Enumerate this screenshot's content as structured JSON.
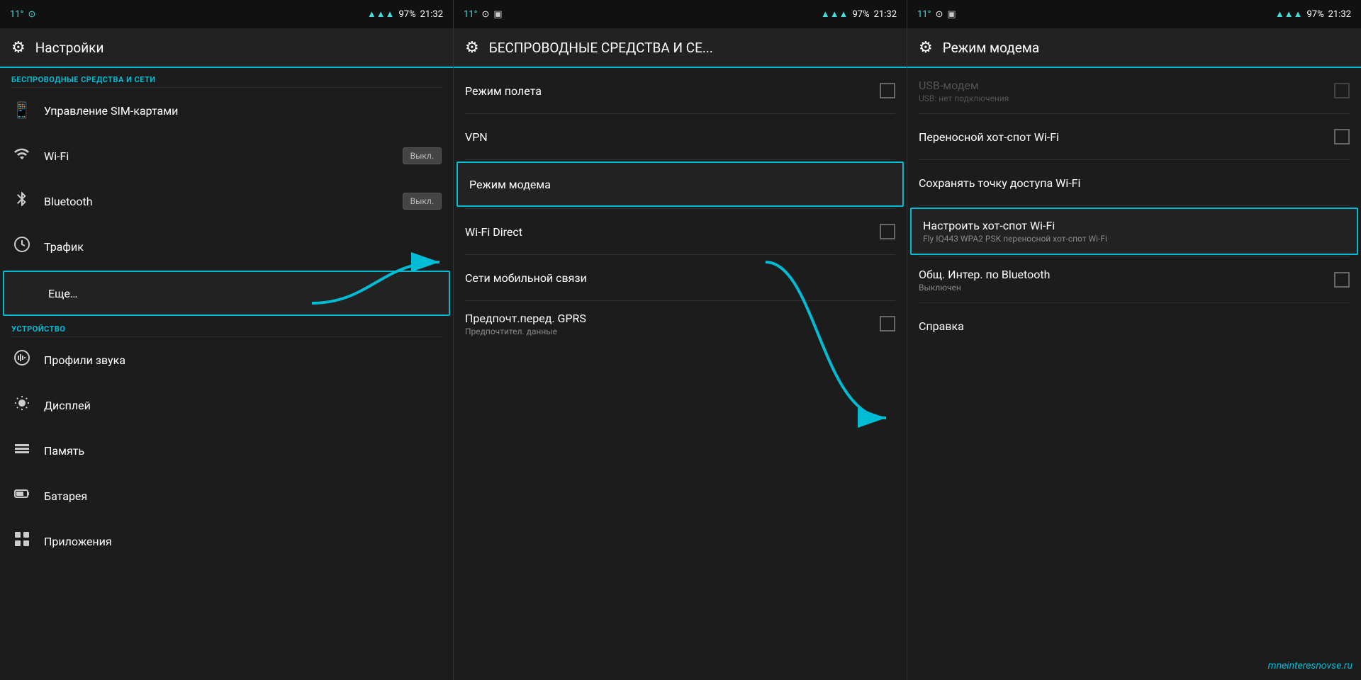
{
  "panel1": {
    "statusBar": {
      "temp": "11°",
      "battery": "97%",
      "time": "21:32"
    },
    "header": {
      "title": "Настройки",
      "icon": "⚙"
    },
    "sections": [
      {
        "label": "БЕСПРОВОДНЫЕ СРЕДСТВА И СЕТИ",
        "items": [
          {
            "icon": "📶",
            "title": "Управление SIM-картами",
            "toggle": null,
            "subtitle": ""
          },
          {
            "icon": "wifi",
            "title": "Wi-Fi",
            "toggle": "Выкл.",
            "subtitle": ""
          },
          {
            "icon": "bluetooth",
            "title": "Bluetooth",
            "toggle": "Выкл.",
            "subtitle": ""
          },
          {
            "icon": "traffic",
            "title": "Трафик",
            "toggle": null,
            "subtitle": ""
          },
          {
            "icon": "more",
            "title": "Еще…",
            "toggle": null,
            "subtitle": "",
            "highlighted": true
          }
        ]
      },
      {
        "label": "УСТРОЙСТВО",
        "items": [
          {
            "icon": "sound",
            "title": "Профили звука",
            "toggle": null,
            "subtitle": ""
          },
          {
            "icon": "display",
            "title": "Дисплей",
            "toggle": null,
            "subtitle": ""
          },
          {
            "icon": "memory",
            "title": "Память",
            "toggle": null,
            "subtitle": ""
          },
          {
            "icon": "battery",
            "title": "Батарея",
            "toggle": null,
            "subtitle": ""
          },
          {
            "icon": "apps",
            "title": "Приложения",
            "toggle": null,
            "subtitle": ""
          }
        ]
      }
    ]
  },
  "panel2": {
    "statusBar": {
      "temp": "11°",
      "battery": "97%",
      "time": "21:32"
    },
    "header": {
      "title": "БЕСПРОВОДНЫЕ СРЕДСТВА И СЕ...",
      "icon": "⚙"
    },
    "items": [
      {
        "title": "Режим полета",
        "subtitle": "",
        "checkbox": true,
        "checked": false,
        "highlighted": false
      },
      {
        "title": "VPN",
        "subtitle": "",
        "checkbox": false,
        "checked": false,
        "highlighted": false
      },
      {
        "title": "Режим модема",
        "subtitle": "",
        "checkbox": false,
        "checked": false,
        "highlighted": true
      },
      {
        "title": "Wi-Fi Direct",
        "subtitle": "",
        "checkbox": true,
        "checked": false,
        "highlighted": false
      },
      {
        "title": "Сети мобильной связи",
        "subtitle": "",
        "checkbox": false,
        "checked": false,
        "highlighted": false
      },
      {
        "title": "Предпочт.перед. GPRS",
        "subtitle": "Предпочтител. данные",
        "checkbox": true,
        "checked": false,
        "highlighted": false
      }
    ]
  },
  "panel3": {
    "statusBar": {
      "temp": "11°",
      "battery": "97%",
      "time": "21:32"
    },
    "header": {
      "title": "Режим модема",
      "icon": "⚙"
    },
    "items": [
      {
        "title": "USB-модем",
        "subtitle": "USB: нет подключения",
        "checkbox": true,
        "checked": false,
        "highlighted": false,
        "disabled": true
      },
      {
        "title": "Переносной хот-спот Wi-Fi",
        "subtitle": "",
        "checkbox": true,
        "checked": false,
        "highlighted": false
      },
      {
        "title": "Сохранять точку доступа Wi-Fi",
        "subtitle": "",
        "checkbox": false,
        "checked": false,
        "highlighted": false
      },
      {
        "title": "Настроить хот-спот Wi-Fi",
        "subtitle": "Fly IQ443 WPA2 PSK переносной хот-спот Wi-Fi",
        "checkbox": false,
        "checked": false,
        "highlighted": true
      },
      {
        "title": "Общ. Интер. по Bluetooth",
        "subtitle": "Выключен",
        "checkbox": true,
        "checked": false,
        "highlighted": false
      },
      {
        "title": "Справка",
        "subtitle": "",
        "checkbox": false,
        "checked": false,
        "highlighted": false
      }
    ],
    "watermark": "mneinteresnovse.ru"
  }
}
